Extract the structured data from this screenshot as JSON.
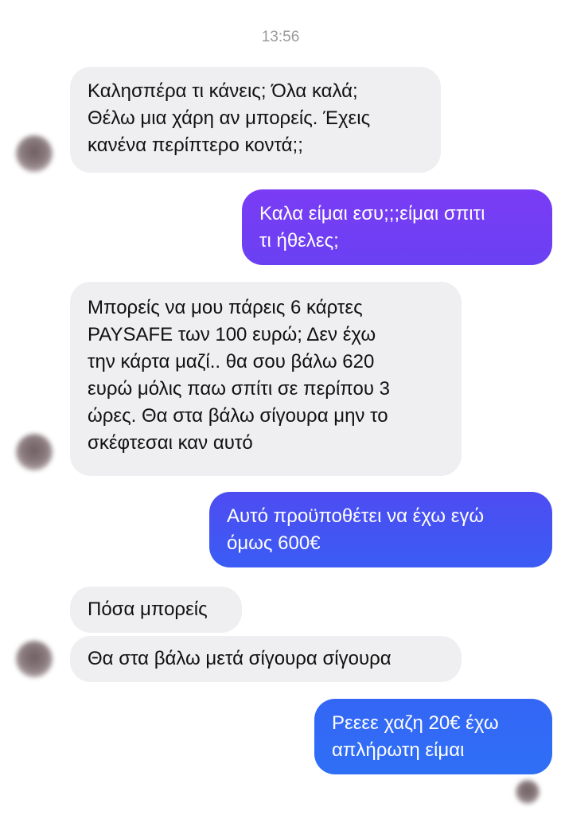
{
  "chat": {
    "timestamp": "13:56",
    "messages": [
      {
        "sender": "contact",
        "text": "Καλησπέρα τι κάνεις; Όλα καλά;\nΘέλω μια χάρη αν μπορείς. Έχεις\nκανένα περίπτερο κοντά;;"
      },
      {
        "sender": "me",
        "text": "Καλα είμαι εσυ;;;είμαι σπιτι\nτι ήθελες;"
      },
      {
        "sender": "contact",
        "text": "Μπορείς να μου πάρεις 6 κάρτες\nPAYSAFE των 100 ευρώ; Δεν έχω\nτην κάρτα μαζί.. θα σου βάλω 620\nευρώ μόλις παω σπίτι σε περίπου 3\nώρες. Θα στα βάλω σίγουρα μην το\nσκέφτεσαι καν αυτό"
      },
      {
        "sender": "me",
        "text": "Αυτό προϋποθέτει να έχω εγώ\nόμως 600€"
      },
      {
        "sender": "contact",
        "text": "Πόσα μπορείς"
      },
      {
        "sender": "contact",
        "text": "Θα στα βάλω μετά σίγουρα σίγουρα"
      },
      {
        "sender": "me",
        "text": "Ρεεεε χαζη 20€ έχω\nαπλήρωτη είμαι"
      }
    ]
  },
  "colors": {
    "incoming_bubble": "#efeff1",
    "outgoing_gradient_top": "#7a3cf4",
    "outgoing_gradient_mid": "#5a47f2",
    "outgoing_gradient_bottom": "#2f6ff6",
    "timestamp_text": "#9a9a9a"
  },
  "icons": {
    "contact_avatar": "blurred-profile-photo",
    "read_receipt": "blurred-seen-avatar"
  }
}
